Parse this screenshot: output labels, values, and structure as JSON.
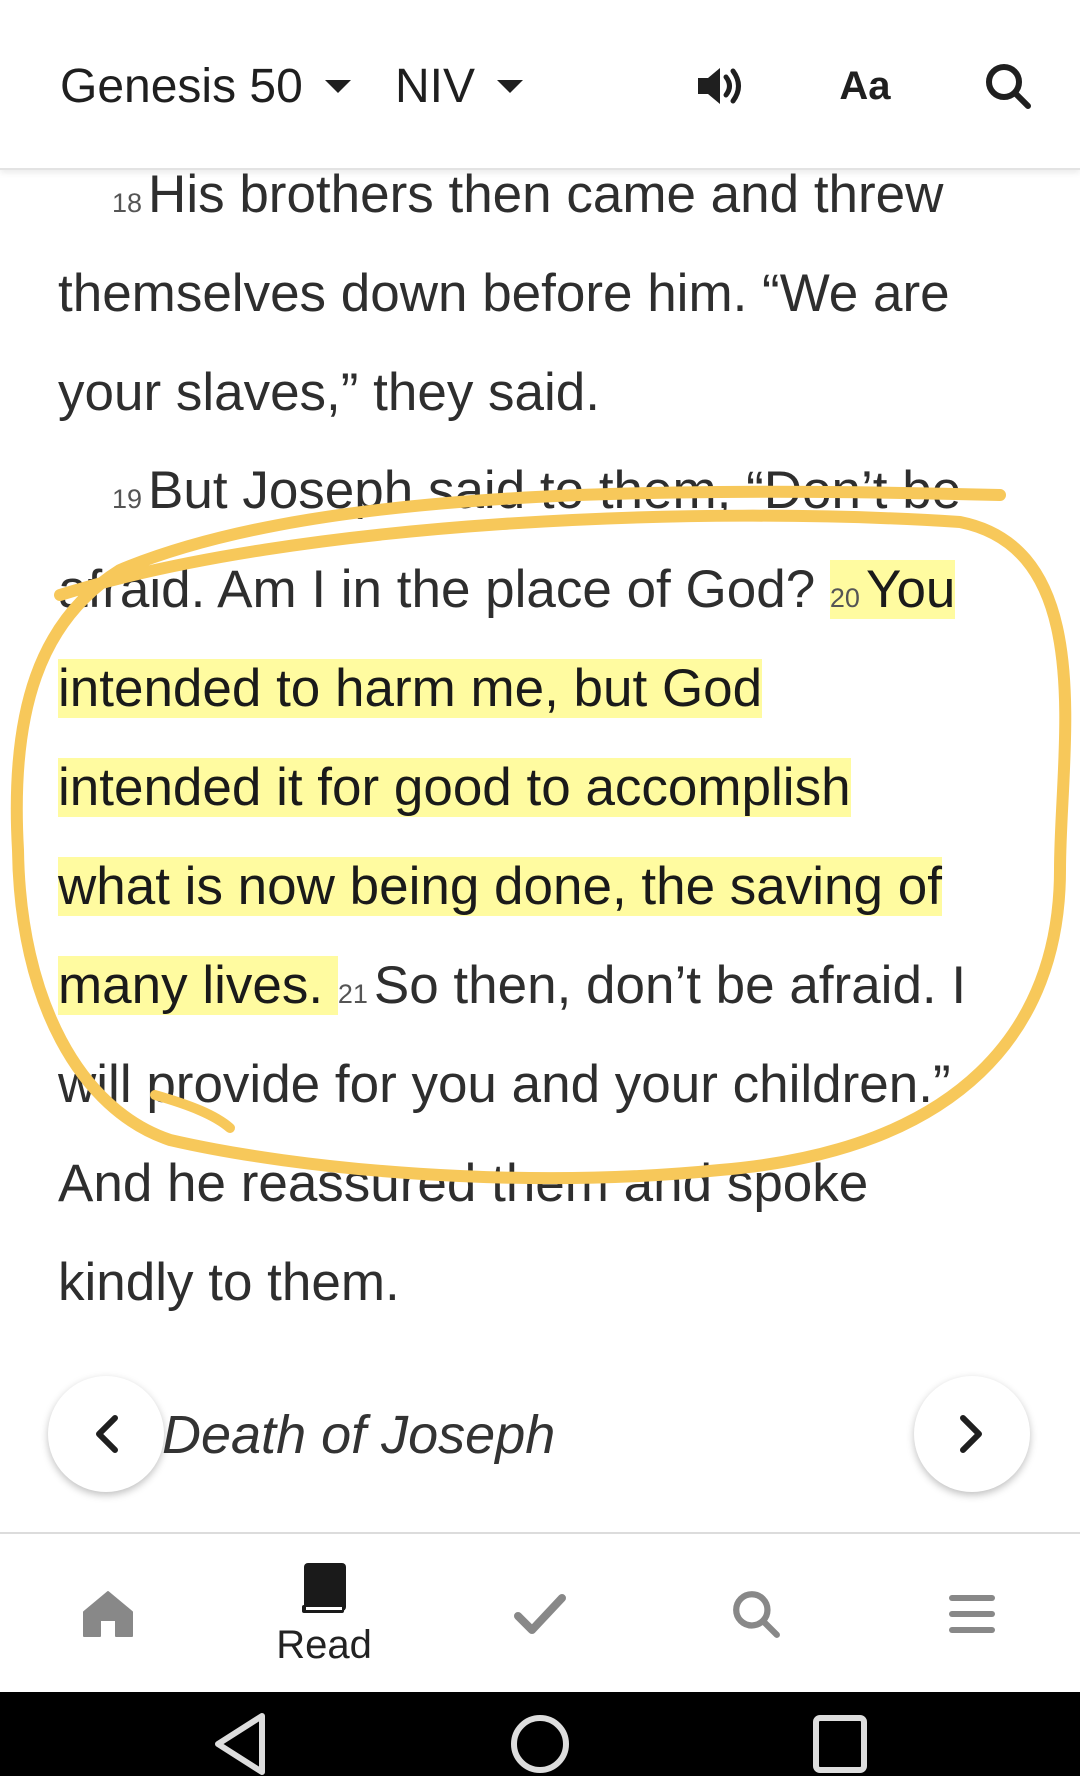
{
  "header": {
    "book_chapter": "Genesis 50",
    "version": "NIV",
    "font_label": "Aa"
  },
  "passage": {
    "v18": {
      "num": "18",
      "line1": "His brothers then came and threw",
      "line2": "themselves down before him. “We are",
      "line3": "your slaves,” they said."
    },
    "v19": {
      "num": "19",
      "line1": "But Joseph said to them, “Don’t be",
      "line2": "afraid. Am I in the place of God?"
    },
    "v20": {
      "num": "20",
      "line1": "You",
      "line2": "intended to harm me, but God",
      "line3": "intended it for good to accomplish",
      "line4": "what is now being done, the saving of",
      "line5": "many lives. "
    },
    "v21": {
      "num": "21",
      "line1": "So then, don’t be afraid. I",
      "line2": "will provide for you and your children.”",
      "line3": "And he reassured them and spoke",
      "line4": "kindly to them."
    }
  },
  "section_nav": {
    "title": "Death of Joseph"
  },
  "bottom_nav": {
    "read_label": "Read"
  },
  "colors": {
    "highlight": "#fffba0",
    "annotation": "#f7c85a"
  }
}
